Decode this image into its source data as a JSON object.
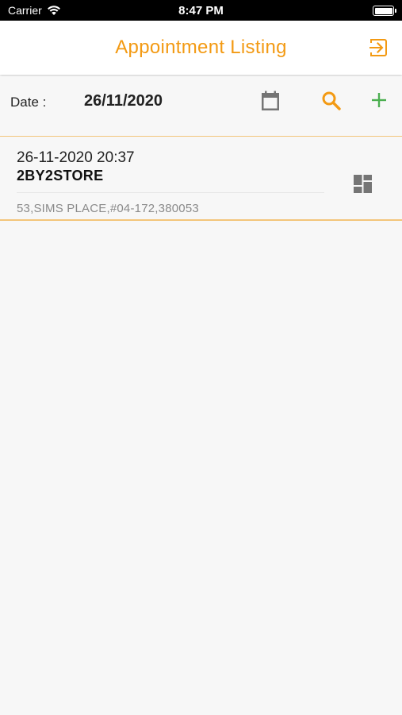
{
  "status_bar": {
    "carrier": "Carrier",
    "time": "8:47 PM"
  },
  "header": {
    "title": "Appointment Listing",
    "logout_icon": "logout-icon"
  },
  "filter": {
    "date_label": "Date :",
    "date_value": "26/11/2020",
    "icons": [
      "calendar-icon",
      "search-icon",
      "add-icon"
    ]
  },
  "appointments": [
    {
      "datetime": "26-11-2020 20:37",
      "store": "2BY2STORE",
      "address": "53,SIMS PLACE,#04-172,380053",
      "icon": "dashboard-icon"
    }
  ],
  "colors": {
    "accent": "#f39a13",
    "add": "#4caf50",
    "icon_gray": "#757575",
    "divider": "#f3c57a",
    "background": "#f7f7f7"
  }
}
